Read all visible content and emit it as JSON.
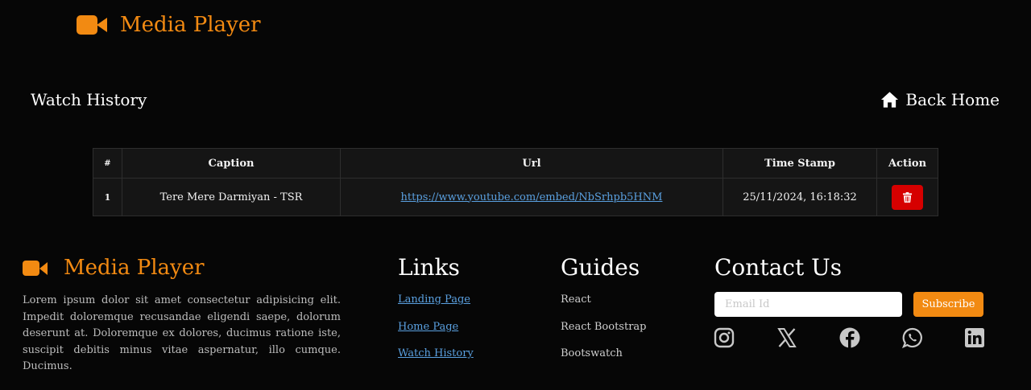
{
  "header": {
    "brand": "Media Player",
    "brand_icon": "video-camera-icon",
    "accent": "#f28a12"
  },
  "page": {
    "title": "Watch History",
    "back_home": "Back Home",
    "back_home_icon": "home-icon"
  },
  "table": {
    "headers": [
      "#",
      "Caption",
      "Url",
      "Time Stamp",
      "Action"
    ],
    "rows": [
      {
        "index": "1",
        "caption": "Tere Mere Darmiyan - TSR",
        "url": "https://www.youtube.com/embed/NbSrhpb5HNM",
        "timestamp": "25/11/2024, 16:18:32",
        "action_icon": "trash-icon"
      }
    ]
  },
  "footer": {
    "brand": "Media Player",
    "description": "Lorem ipsum dolor sit amet consectetur adipisicing elit. Impedit doloremque recusandae eligendi saepe, dolorum deserunt at. Doloremque ex dolores, ducimus ratione iste, suscipit debitis minus vitae aspernatur, illo cumque. Ducimus.",
    "links_title": "Links",
    "links": [
      "Landing Page",
      "Home Page",
      "Watch History"
    ],
    "guides_title": "Guides",
    "guides": [
      "React",
      "React Bootstrap",
      "Bootswatch"
    ],
    "contact_title": "Contact Us",
    "email_placeholder": "Email Id",
    "subscribe_label": "Subscribe",
    "social_icons": [
      "instagram-icon",
      "x-icon",
      "facebook-icon",
      "whatsapp-icon",
      "linkedin-icon"
    ]
  }
}
